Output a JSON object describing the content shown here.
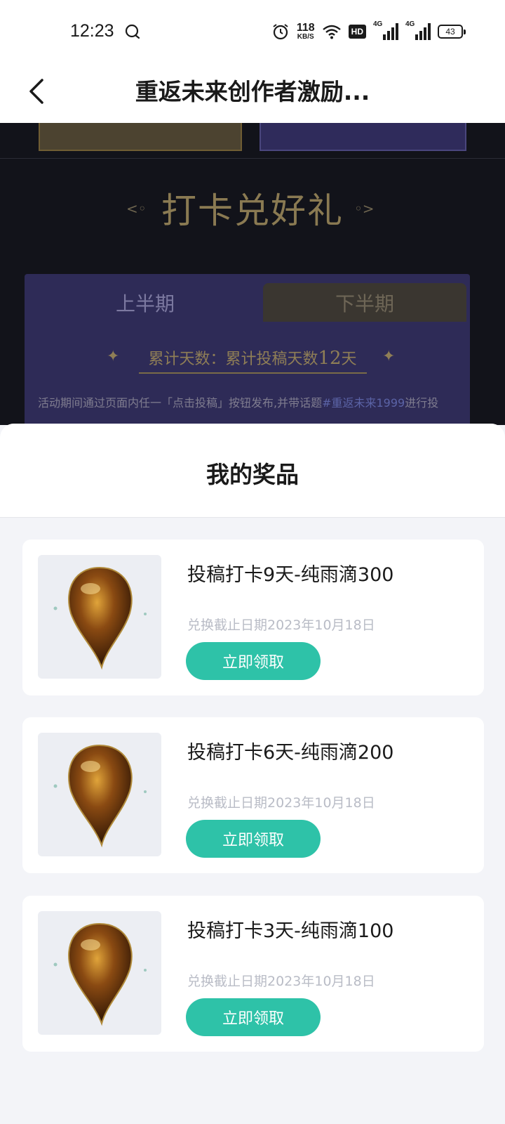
{
  "status_bar": {
    "time": "12:23",
    "net_speed_value": "118",
    "net_speed_unit": "KB/S",
    "hd_label": "HD",
    "signal1_label": "4G",
    "signal2_label": "4G",
    "battery": "43"
  },
  "header": {
    "title": "重返未来创作者激励..."
  },
  "banner": {
    "title": "打卡兑好礼",
    "tabs": [
      "上半期",
      "下半期"
    ],
    "cumulative_prefix": "累计天数：累计投稿天数",
    "cumulative_days": "12",
    "cumulative_suffix": "天",
    "rule_prefix": "活动期间通过页面内任一「点击投稿」按钮发布,并带话题",
    "rule_tag": "#重返未来1999",
    "rule_suffix": "进行投"
  },
  "sheet": {
    "title": "我的奖品",
    "items": [
      {
        "title": "投稿打卡9天-纯雨滴300",
        "deadline": "兑换截止日期2023年10月18日",
        "button": "立即领取"
      },
      {
        "title": "投稿打卡6天-纯雨滴200",
        "deadline": "兑换截止日期2023年10月18日",
        "button": "立即领取"
      },
      {
        "title": "投稿打卡3天-纯雨滴100",
        "deadline": "兑换截止日期2023年10月18日",
        "button": "立即领取"
      }
    ]
  },
  "colors": {
    "accent": "#2ec2a8",
    "banner_bg": "#12131a",
    "sheet_bg": "#f3f4f8"
  }
}
